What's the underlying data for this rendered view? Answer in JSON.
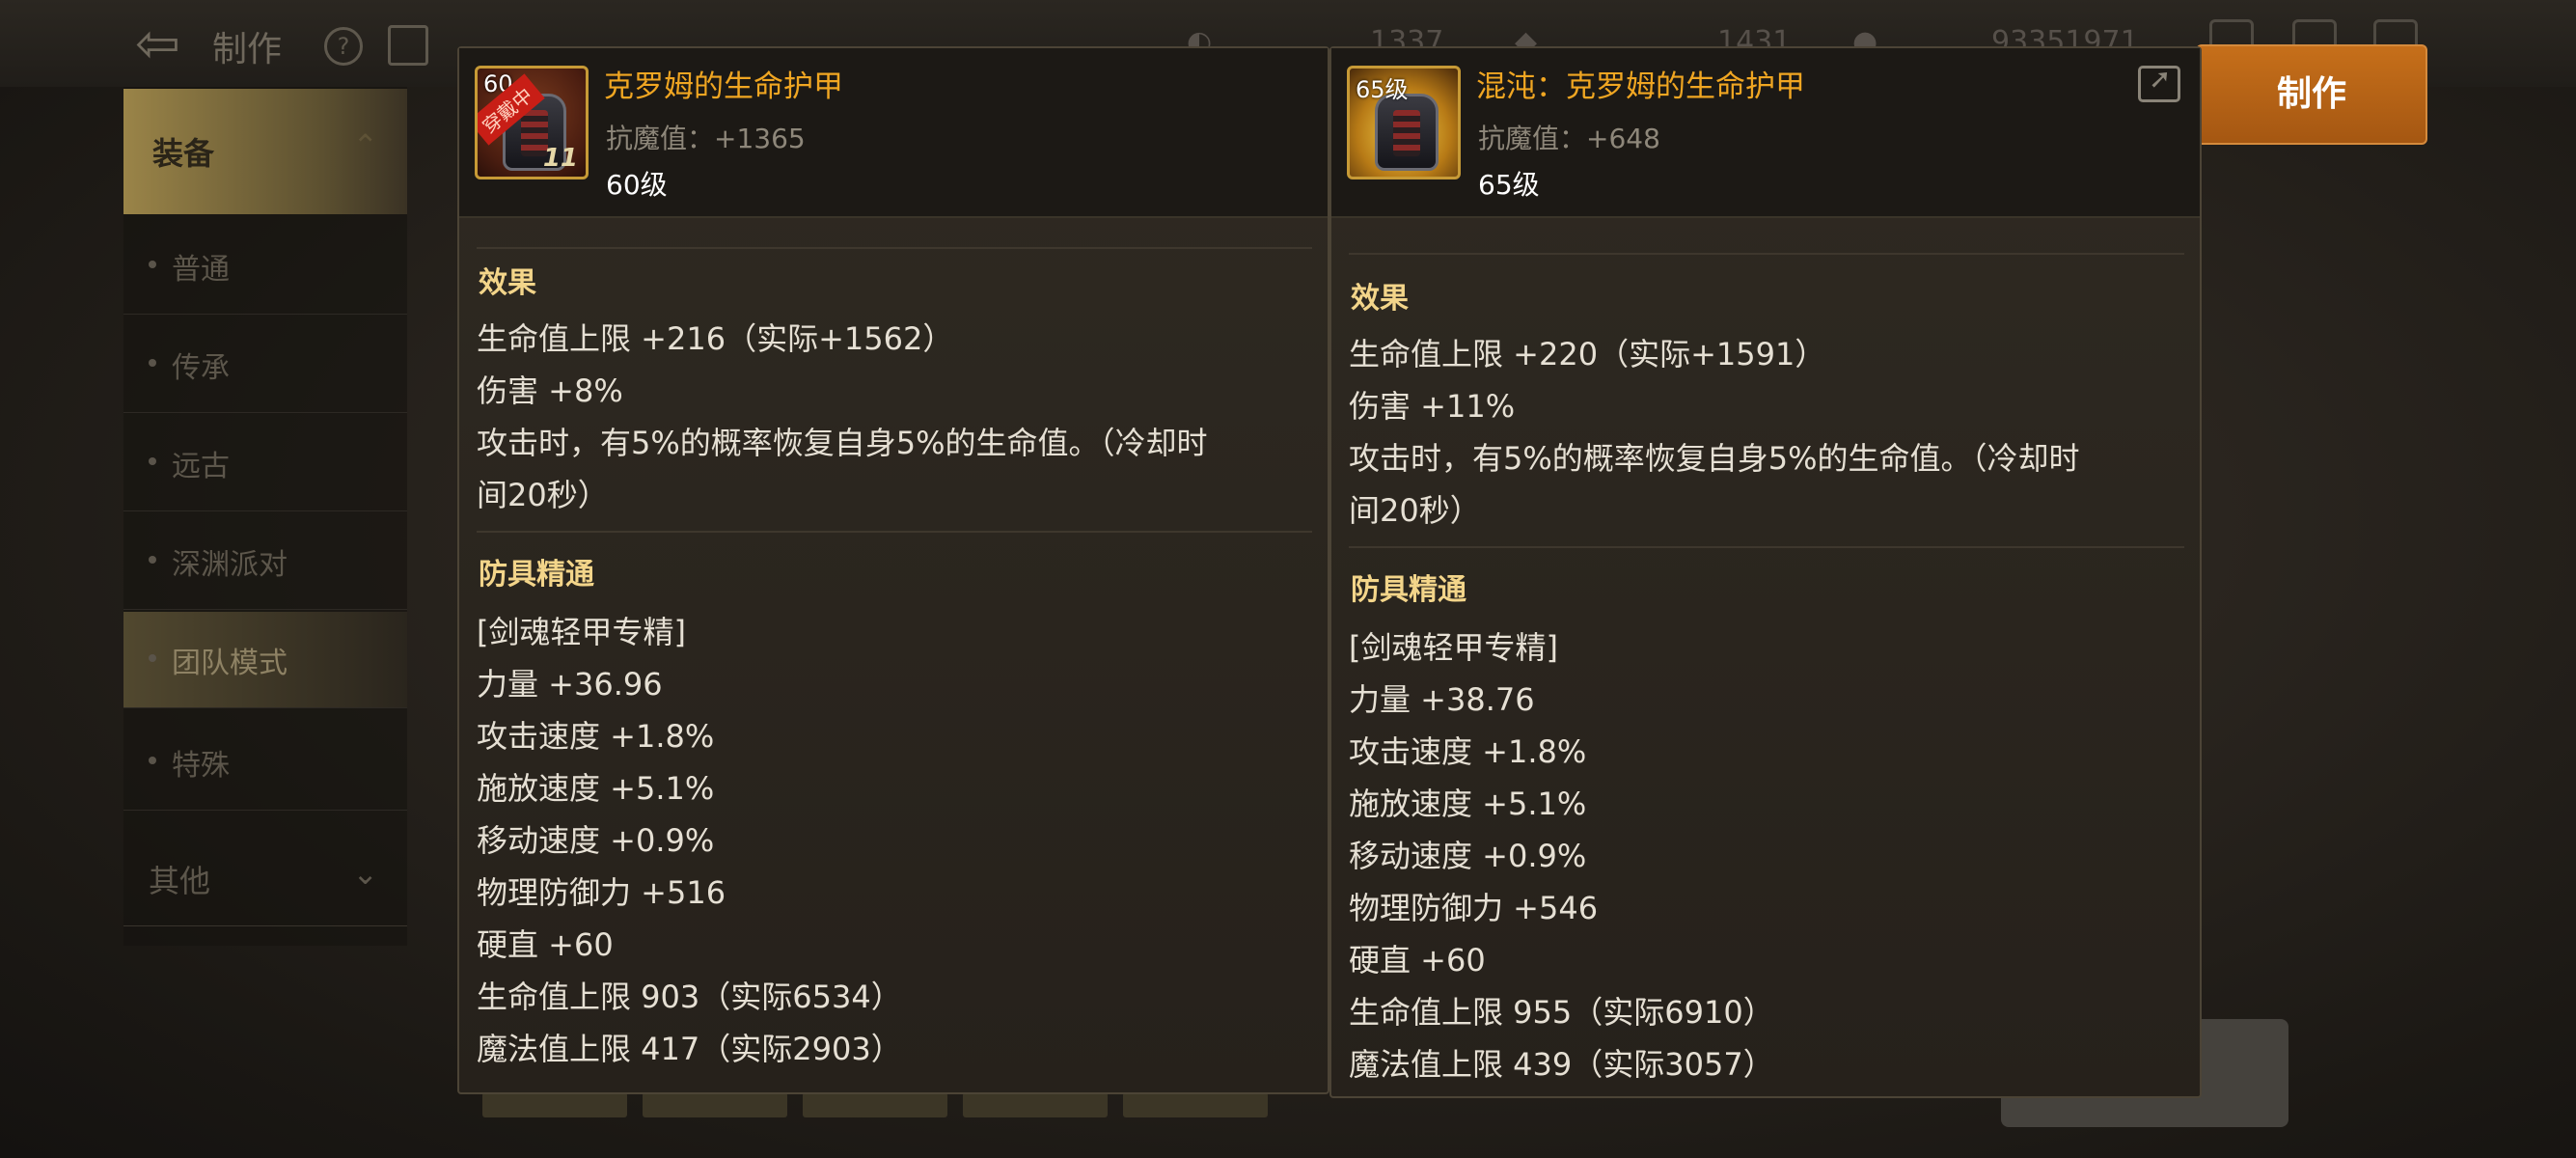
{
  "background": {
    "title": "制作",
    "currencies": [
      "1337",
      "1431",
      "93351971"
    ],
    "sidebar": {
      "category": "装备",
      "items": [
        "普通",
        "传承",
        "远古",
        "深渊派对",
        "团队模式",
        "特殊"
      ],
      "selected_index": 4,
      "other": "其他"
    },
    "make_button": "制作"
  },
  "cards": [
    {
      "name": "克罗姆的生命护甲",
      "icon_level_tag": "60",
      "icon_equipped_tag": "穿戴中",
      "icon_number": "11",
      "resist": "抗魔值：+1365",
      "level": "60级",
      "effect_title": "效果",
      "effects": [
        "生命值上限 +216（实际+1562）",
        "伤害 +8%",
        "攻击时，有5%的概率恢复自身5%的生命值。（冷却时",
        "间20秒）"
      ],
      "mastery_title": "防具精通",
      "mastery": [
        "[剑魂轻甲专精]",
        "力量 +36.96",
        "攻击速度 +1.8%",
        "施放速度 +5.1%",
        "移动速度 +0.9%",
        "物理防御力 +516",
        "硬直 +60",
        "生命值上限 903（实际6534）",
        "魔法值上限 417（实际2903）"
      ]
    },
    {
      "name": "混沌：克罗姆的生命护甲",
      "icon_level_tag": "65级",
      "resist": "抗魔值：+648",
      "level": "65级",
      "effect_title": "效果",
      "effects": [
        "生命值上限 +220（实际+1591）",
        "伤害 +11%",
        "攻击时，有5%的概率恢复自身5%的生命值。（冷却时",
        "间20秒）"
      ],
      "mastery_title": "防具精通",
      "mastery": [
        "[剑魂轻甲专精]",
        "力量 +38.76",
        "攻击速度 +1.8%",
        "施放速度 +5.1%",
        "移动速度 +0.9%",
        "物理防御力 +546",
        "硬直 +60",
        "生命值上限 955（实际6910）",
        "魔法值上限 439（实际3057）"
      ]
    }
  ]
}
